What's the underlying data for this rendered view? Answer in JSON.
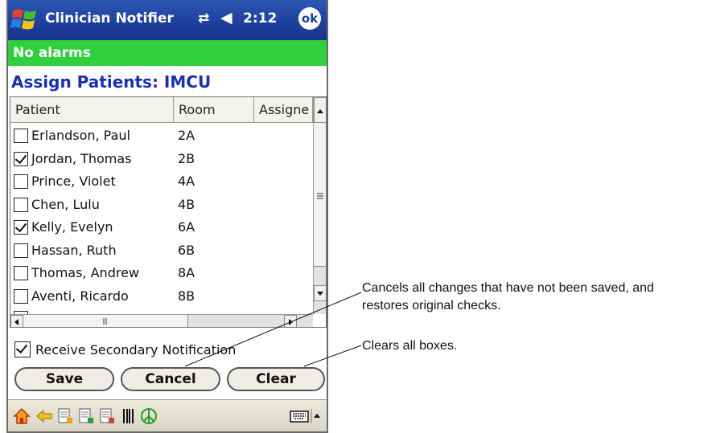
{
  "titlebar": {
    "app_title": "Clinician Notifier",
    "time": "2:12",
    "ok_label": "ok",
    "icons": [
      "windows-start-icon",
      "connectivity-icon",
      "volume-icon"
    ]
  },
  "alarm_status": "No alarms",
  "heading": "Assign Patients: IMCU",
  "columns": [
    "Patient",
    "Room",
    "Assigne"
  ],
  "patients": [
    {
      "name": "Erlandson, Paul",
      "room": "2A",
      "checked": false
    },
    {
      "name": "Jordan, Thomas",
      "room": "2B",
      "checked": true
    },
    {
      "name": "Prince, Violet",
      "room": "4A",
      "checked": false
    },
    {
      "name": "Chen, Lulu",
      "room": "4B",
      "checked": false
    },
    {
      "name": "Kelly, Evelyn",
      "room": "6A",
      "checked": true
    },
    {
      "name": "Hassan, Ruth",
      "room": "6B",
      "checked": false
    },
    {
      "name": "Thomas, Andrew",
      "room": "8A",
      "checked": false
    },
    {
      "name": "Aventi, Ricardo",
      "room": "8B",
      "checked": false
    }
  ],
  "secondary_notification": {
    "label": "Receive Secondary Notification",
    "checked": true
  },
  "buttons": {
    "save": "Save",
    "cancel": "Cancel",
    "clear": "Clear"
  },
  "taskbar_icons": [
    "home-icon",
    "back-arrow-icon",
    "note-icon",
    "note-edit-icon",
    "note-list-icon",
    "barcode-icon",
    "peace-icon",
    "keyboard-icon",
    "up-arrow-icon"
  ],
  "annotations": {
    "cancel_note_line1": "Cancels all changes that have not been saved, and",
    "cancel_note_line2": "restores original checks.",
    "clear_note": "Clears all boxes."
  }
}
